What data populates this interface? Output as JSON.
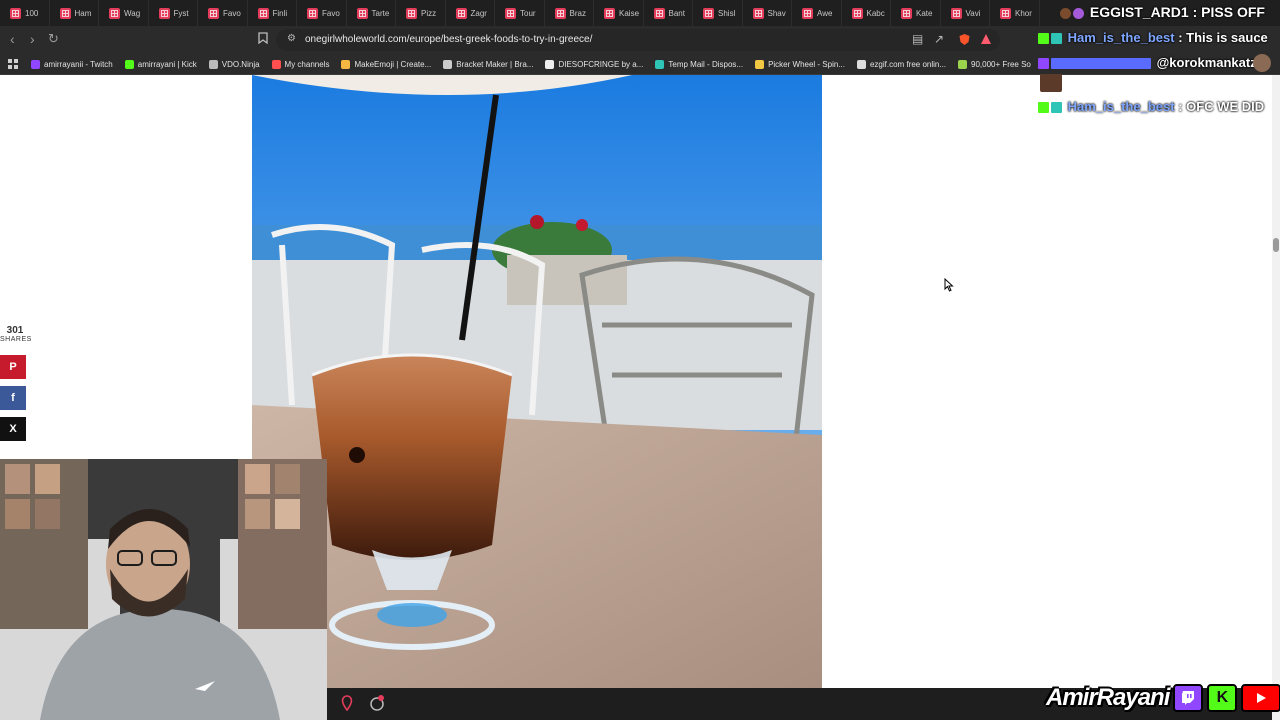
{
  "tabs": [
    "100",
    "Ham",
    "Wag",
    "Fyst",
    "Favo",
    "Finli",
    "Favo",
    "Tarte",
    "Pizz",
    "Zagr",
    "Tour",
    "Braz",
    "Kaise",
    "Bant",
    "Shisl",
    "Shav",
    "Awe",
    "Kabc",
    "Kate",
    "Vavi",
    "Khor"
  ],
  "address": {
    "url": "onegirlwholeworld.com/europe/best-greek-foods-to-try-in-greece/"
  },
  "bookmarks": [
    {
      "label": "amirrayanii - Twitch",
      "color": "#9146ff"
    },
    {
      "label": "amirrayani | Kick",
      "color": "#53fc18"
    },
    {
      "label": "VDO.Ninja",
      "color": "#bbbbbb"
    },
    {
      "label": "My channels",
      "color": "#ff4f4f"
    },
    {
      "label": "MakeEmoji | Create...",
      "color": "#f5b642"
    },
    {
      "label": "Bracket Maker | Bra...",
      "color": "#cccccc"
    },
    {
      "label": "DIESOFCRINGE by a...",
      "color": "#eeeeee"
    },
    {
      "label": "Temp Mail - Dispos...",
      "color": "#2ec4b6"
    },
    {
      "label": "Picker Wheel - Spin...",
      "color": "#f2c744"
    },
    {
      "label": "ezgif.com free onlin...",
      "color": "#dddddd"
    },
    {
      "label": "90,000+ Free So",
      "color": "#9bd34c"
    }
  ],
  "share": {
    "count": "301",
    "label": "SHARES",
    "pinterest": "P",
    "facebook": "f",
    "x": "X"
  },
  "chat": [
    {
      "user": "EGGIST_ARD1",
      "sep": " : ",
      "message": "PISS OFF",
      "userColor": "#ffffff"
    },
    {
      "user": "Ham_is_the_best",
      "sep": " : ",
      "message": "This is sauce",
      "userColor": "#7fa6ff"
    },
    {
      "user": "",
      "sep": "",
      "message": "@korokmankatz",
      "userColor": "#5a6bff"
    },
    {
      "user": "Ham_is_the_best",
      "sep": " : ",
      "message": "OFC WE DID",
      "userColor": "#7fa6ff"
    }
  ],
  "brand": {
    "name": "AmirRayani",
    "twitchColor": "#9146ff",
    "kickColor": "#53fc18",
    "youtubeColor": "#ff0000"
  },
  "icons": {
    "back": "chevron-left",
    "forward": "chevron-right",
    "reload": "reload",
    "bookmark": "bookmark",
    "apps": "grid"
  }
}
